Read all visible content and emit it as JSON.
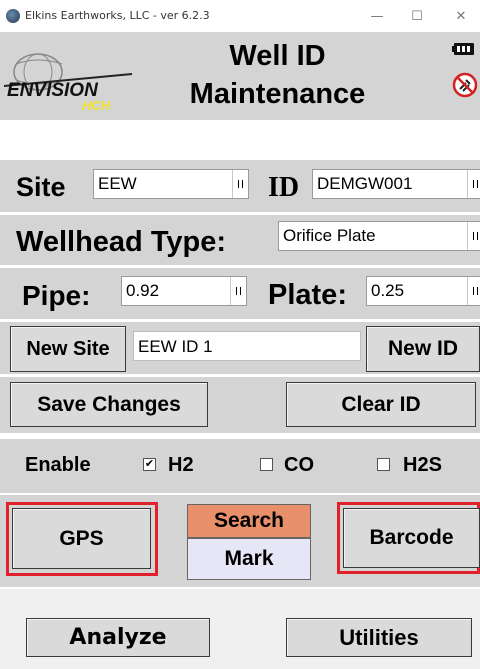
{
  "window": {
    "title": "Elkins Earthworks, LLC - ver 6.2.3",
    "minimize": "—",
    "maximize": "☐",
    "close": "✕"
  },
  "header": {
    "logo_text": "ENVISION",
    "logo_sub": "HCH",
    "title_line1": "Well ID",
    "title_line2": "Maintenance",
    "icons": [
      "battery-icon",
      "no-signal-icon"
    ]
  },
  "site": {
    "label": "Site",
    "value": "EEW"
  },
  "id": {
    "label": "ID",
    "value": "DEMGW001"
  },
  "wellhead": {
    "label": "Wellhead Type:",
    "value": "Orifice Plate"
  },
  "pipe": {
    "label": "Pipe:",
    "value": "0.92"
  },
  "plate": {
    "label": "Plate:",
    "value": "0.25"
  },
  "new_site": {
    "button": "New Site",
    "value": "EEW ID 1"
  },
  "new_id": {
    "button": "New ID"
  },
  "actions": {
    "save": "Save Changes",
    "clear": "Clear ID"
  },
  "enable": {
    "label": "Enable",
    "options": [
      {
        "label": "H2",
        "checked": true
      },
      {
        "label": "CO",
        "checked": false
      },
      {
        "label": "H2S",
        "checked": false
      }
    ]
  },
  "gps": {
    "label": "GPS"
  },
  "search": {
    "label": "Search",
    "color": "#e8906a"
  },
  "mark": {
    "label": "Mark"
  },
  "barcode": {
    "label": "Barcode"
  },
  "footer": {
    "analyze": "Analyze",
    "utilities": "Utilities"
  },
  "colors": {
    "panel": "#d4d4d4",
    "highlight": "#e0202a",
    "logo_yellow": "#f2e32a"
  }
}
